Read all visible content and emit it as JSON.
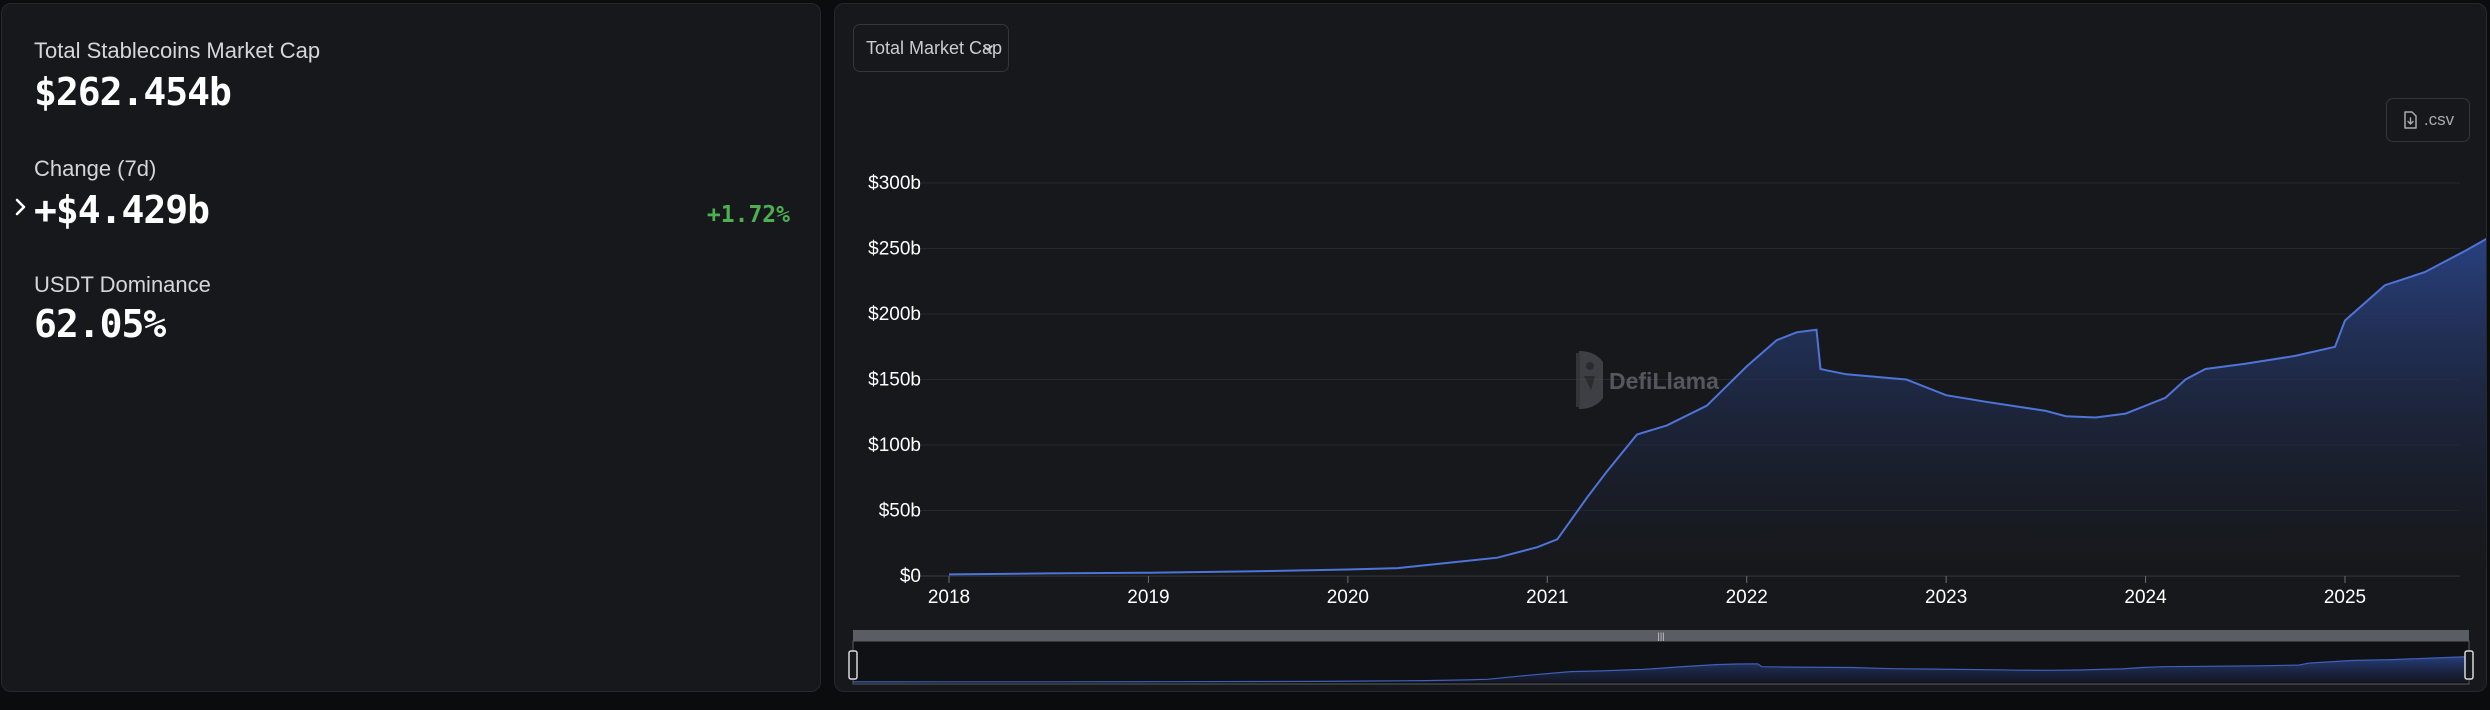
{
  "summary": {
    "market_cap_label": "Total Stablecoins Market Cap",
    "market_cap_value": "$262.454b",
    "change_label": "Change (7d)",
    "change_value": "+$4.429b",
    "change_pct": "+1.72%",
    "dominance_label": "USDT Dominance",
    "dominance_value": "62.05%"
  },
  "controls": {
    "dropdown_label": "Total Market Cap",
    "csv_label": ".csv",
    "csv_icon": "file-download-icon",
    "dropdown_icon": "chevron-down-icon",
    "expand_icon": "chevron-right-icon"
  },
  "watermark": {
    "text": "DefiLlama",
    "icon": "llama-logo"
  },
  "colors": {
    "accent_line": "#4f74d8",
    "area_top": "#2a4488",
    "area_bottom": "#17181b",
    "positive": "#4caf50",
    "grid": "#26282d",
    "axis_text": "#ffffff"
  },
  "chart_data": {
    "type": "area",
    "title": "",
    "xlabel": "",
    "ylabel": "",
    "ylim": [
      0,
      300
    ],
    "xlim": [
      2018.0,
      2025.77
    ],
    "y_unit": "billion USD",
    "y_ticks": [
      0,
      50,
      100,
      150,
      200,
      250,
      300
    ],
    "y_tick_labels": [
      "$0",
      "$50b",
      "$100b",
      "$150b",
      "$200b",
      "$250b",
      "$300b"
    ],
    "x_ticks": [
      2018,
      2019,
      2020,
      2021,
      2022,
      2023,
      2024,
      2025
    ],
    "x_tick_labels": [
      "2018",
      "2019",
      "2020",
      "2021",
      "2022",
      "2023",
      "2024",
      "2025"
    ],
    "grid": true,
    "legend": "none",
    "series": [
      {
        "x": [
          2018.0,
          2018.5,
          2019.0,
          2019.5,
          2020.0,
          2020.25,
          2020.5,
          2020.75,
          2020.95,
          2021.05,
          2021.2,
          2021.3,
          2021.45,
          2021.6,
          2021.8,
          2022.0,
          2022.15,
          2022.25,
          2022.35,
          2022.37,
          2022.4,
          2022.5,
          2022.8,
          2023.0,
          2023.2,
          2023.5,
          2023.6,
          2023.75,
          2023.9,
          2024.0,
          2024.1,
          2024.2,
          2024.3,
          2024.5,
          2024.75,
          2024.95,
          2025.0,
          2025.2,
          2025.4,
          2025.6,
          2025.77
        ],
        "values": [
          1.2,
          2,
          2.5,
          3.5,
          5,
          6,
          10,
          14,
          22,
          28,
          60,
          80,
          108,
          115,
          130,
          160,
          180,
          186,
          188,
          158,
          157,
          154,
          150,
          138,
          133,
          126,
          122,
          121,
          124,
          130,
          136,
          150,
          158,
          162,
          168,
          175,
          195,
          222,
          232,
          248,
          262.5
        ]
      }
    ]
  }
}
